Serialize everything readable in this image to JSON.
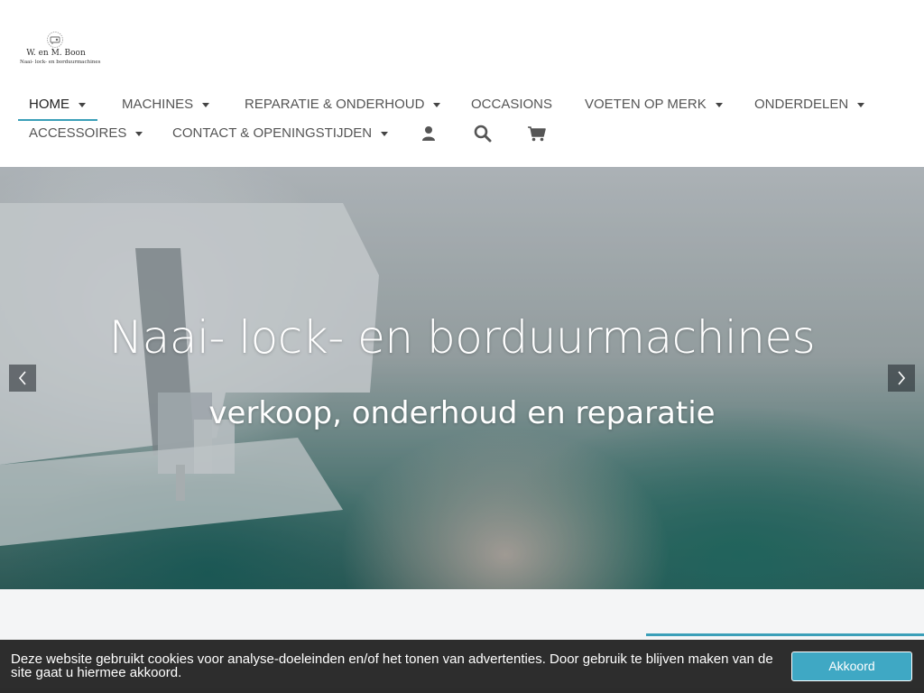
{
  "logo": {
    "brand": "W. en M. Boon",
    "tagline": "Naai- lock- en borduurmachines"
  },
  "nav": {
    "items": [
      {
        "label": "HOME",
        "dropdown": true,
        "active": true
      },
      {
        "label": "MACHINES",
        "dropdown": true
      },
      {
        "label": "REPARATIE & ONDERHOUD",
        "dropdown": true
      },
      {
        "label": "OCCASIONS",
        "dropdown": false
      },
      {
        "label": "VOETEN OP MERK",
        "dropdown": true
      },
      {
        "label": "ONDERDELEN",
        "dropdown": true
      },
      {
        "label": "ACCESSOIRES",
        "dropdown": true
      },
      {
        "label": "CONTACT & OPENINGSTIJDEN",
        "dropdown": true
      }
    ],
    "icons": [
      "user-icon",
      "search-icon",
      "cart-icon"
    ]
  },
  "hero": {
    "title": "Naai- lock- en borduurmachines",
    "subtitle": "verkoop, onderhoud en reparatie"
  },
  "cookie": {
    "text": "Deze website gebruikt cookies voor analyse-doeleinden en/of het tonen van advertenties. Door gebruik te blijven maken van de site gaat u hiermee akkoord.",
    "button_label": "Akkoord"
  },
  "colors": {
    "accent": "#3a9fb8",
    "cookie_button": "#3fa8c4",
    "cookie_bar": "#242424",
    "nav_text": "#555555"
  }
}
